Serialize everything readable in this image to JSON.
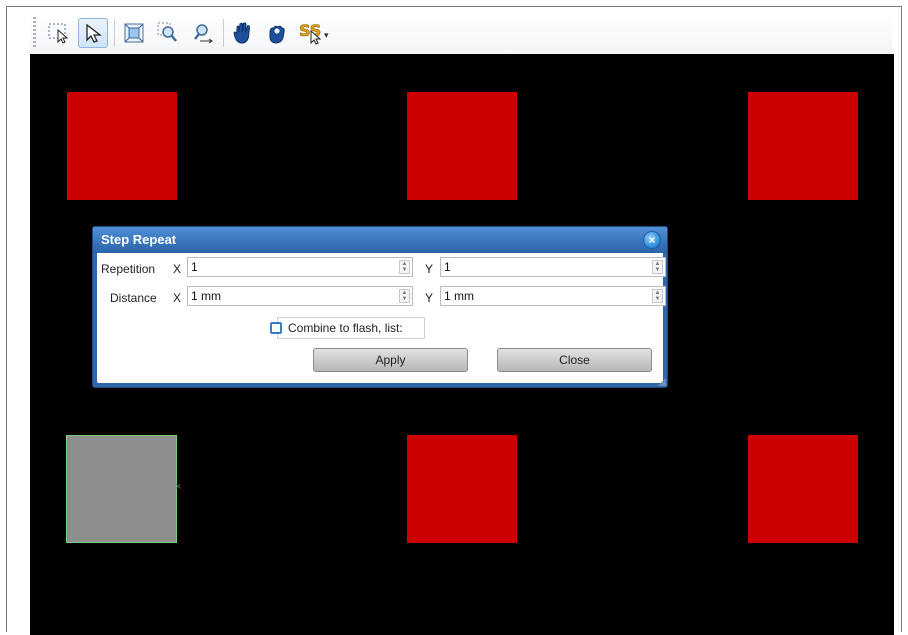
{
  "toolbar": {
    "buttons": [
      {
        "icon": "lasso-select-icon",
        "active": false
      },
      {
        "icon": "select-arrow-icon",
        "active": true
      },
      {
        "icon": "zoom-fit-icon",
        "active": false
      },
      {
        "icon": "zoom-window-icon",
        "active": false
      },
      {
        "icon": "zoom-pan-icon",
        "active": false
      },
      {
        "icon": "hand-pan-icon",
        "active": false
      },
      {
        "icon": "hand-grab-icon",
        "active": false
      },
      {
        "icon": "snap-icon",
        "active": false
      }
    ],
    "dropdown_glyph": "▾"
  },
  "canvas": {
    "background": "#000000",
    "pad_color": "#cc0000",
    "selected_pad_color": "#8e8e8e",
    "cursor_mark": "×"
  },
  "dialog": {
    "title": "Step  Repeat",
    "close_glyph": "×",
    "repetition_label": "Repetition",
    "distance_label": "Distance",
    "x_label": "X",
    "y_label": "Y",
    "repetition_x": "1",
    "repetition_y": "1",
    "distance_x": "1 mm",
    "distance_y": "1 mm",
    "combine_label": "Combine to flash, list:",
    "combine_checked": false,
    "apply_label": "Apply",
    "close_label": "Close"
  }
}
